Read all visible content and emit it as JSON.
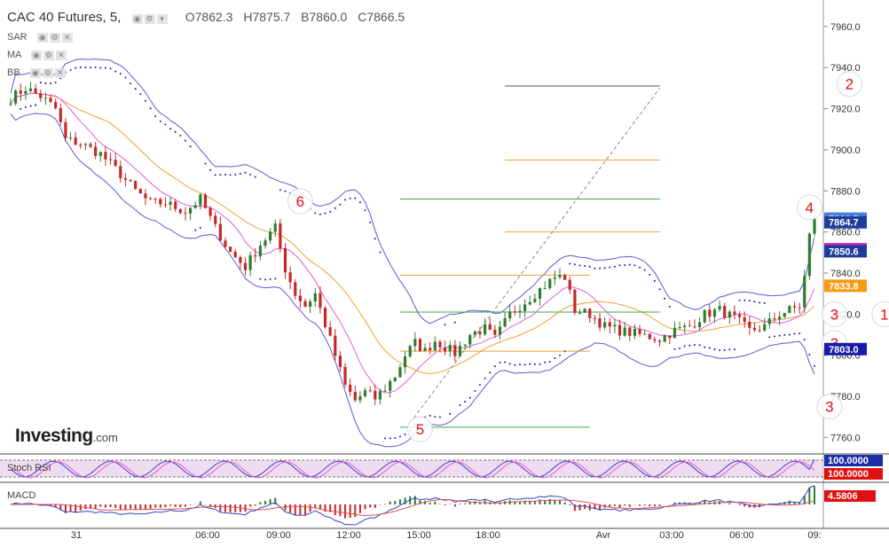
{
  "header": {
    "title": "CAC 40 Futures, 5,",
    "ohlc": {
      "open": "O7862.3",
      "high": "H7875.7",
      "low": "B7860.0",
      "close": "C7866.5"
    }
  },
  "indicators": [
    "SAR",
    "MA",
    "BB"
  ],
  "logo": {
    "name": "Investing",
    "suffix": ".com"
  },
  "chart_data": {
    "type": "candlestick",
    "price_axis": {
      "ylim": [
        7752,
        7972
      ],
      "ticks": [
        "7960.0",
        "7940.0",
        "7920.0",
        "7900.0",
        "7880.0",
        "7860.0",
        "7840.0",
        "7820.0",
        "7800.0",
        "7780.0",
        "7760.0"
      ]
    },
    "time_axis": {
      "labels": [
        "31",
        "06:00",
        "09:00",
        "12:00",
        "15:00",
        "18:00",
        "Avr",
        "03:00",
        "06:00",
        "09:"
      ]
    },
    "close_path": [
      [
        0,
        7925
      ],
      [
        3,
        7930
      ],
      [
        6,
        7926
      ],
      [
        9,
        7920
      ],
      [
        11,
        7905
      ],
      [
        14,
        7903
      ],
      [
        18,
        7898
      ],
      [
        22,
        7888
      ],
      [
        25,
        7880
      ],
      [
        28,
        7874
      ],
      [
        31,
        7874
      ],
      [
        35,
        7870
      ],
      [
        38,
        7876
      ],
      [
        41,
        7862
      ],
      [
        44,
        7850
      ],
      [
        47,
        7843
      ],
      [
        50,
        7854
      ],
      [
        53,
        7862
      ],
      [
        55,
        7842
      ],
      [
        57,
        7830
      ],
      [
        59,
        7824
      ],
      [
        61,
        7830
      ],
      [
        63,
        7815
      ],
      [
        65,
        7800
      ],
      [
        67,
        7785
      ],
      [
        69,
        7778
      ],
      [
        71,
        7782
      ],
      [
        73,
        7779
      ],
      [
        75,
        7784
      ],
      [
        77,
        7790
      ],
      [
        79,
        7800
      ],
      [
        81,
        7806
      ],
      [
        83,
        7802
      ],
      [
        85,
        7807
      ],
      [
        87,
        7804
      ],
      [
        89,
        7801
      ],
      [
        92,
        7810
      ],
      [
        95,
        7813
      ],
      [
        97,
        7808
      ],
      [
        100,
        7820
      ],
      [
        103,
        7826
      ],
      [
        106,
        7832
      ],
      [
        109,
        7838
      ],
      [
        111,
        7838
      ],
      [
        113,
        7822
      ],
      [
        116,
        7820
      ],
      [
        119,
        7814
      ],
      [
        122,
        7812
      ],
      [
        126,
        7810
      ],
      [
        130,
        7808
      ],
      [
        133,
        7812
      ],
      [
        136,
        7814
      ],
      [
        139,
        7820
      ],
      [
        142,
        7822
      ],
      [
        145,
        7818
      ],
      [
        148,
        7812
      ],
      [
        151,
        7814
      ],
      [
        154,
        7820
      ],
      [
        156,
        7822
      ],
      [
        158,
        7824
      ],
      [
        159,
        7838
      ],
      [
        160,
        7858
      ],
      [
        161,
        7866.5
      ]
    ],
    "price_tags": [
      {
        "value": "7866.5",
        "price": 7866.5,
        "color": "#4a7fdb"
      },
      {
        "value": "7864.7",
        "price": 7864.7,
        "color": "#1c3d9c"
      },
      {
        "value": "7851.6",
        "price": 7851.6,
        "color": "#e01ec4"
      },
      {
        "value": "7850.6",
        "price": 7850.6,
        "color": "#1c3d9c"
      },
      {
        "value": "7833.8",
        "price": 7833.8,
        "color": "#f59b12"
      },
      {
        "value": "7803.0",
        "price": 7803.0,
        "color": "#1a1aa8"
      }
    ],
    "horizontal_levels": [
      {
        "price": 7931,
        "x": [
          99,
          130
        ],
        "color": "#555555"
      },
      {
        "price": 7895,
        "x": [
          99,
          130
        ],
        "color": "#f0a030"
      },
      {
        "price": 7876,
        "x": [
          78,
          130
        ],
        "color": "#3aa84a"
      },
      {
        "price": 7860,
        "x": [
          99,
          130
        ],
        "color": "#f0a030"
      },
      {
        "price": 7839,
        "x": [
          78,
          116
        ],
        "color": "#f0a030"
      },
      {
        "price": 7821,
        "x": [
          78,
          130
        ],
        "color": "#3aa84a"
      },
      {
        "price": 7802,
        "x": [
          78,
          116
        ],
        "color": "#f0a030"
      },
      {
        "price": 7765,
        "x": [
          78,
          116
        ],
        "color": "#3aa84a"
      }
    ],
    "trend_line": {
      "from": [
        80,
        7767
      ],
      "to": [
        130,
        7930
      ]
    },
    "wave_labels": [
      {
        "text": "2",
        "x": 168,
        "price": 7932,
        "circle": true
      },
      {
        "text": "6",
        "x": 58,
        "price": 7875,
        "circle": true
      },
      {
        "text": "4",
        "x": 160,
        "price": 7872,
        "circle": true
      },
      {
        "text": "3",
        "x": 165,
        "price": 7820,
        "circle": true
      },
      {
        "text": "1",
        "x": 175,
        "price": 7820,
        "circle": true
      },
      {
        "text": "3",
        "x": 165,
        "price": 7806,
        "circle": true
      },
      {
        "text": "5",
        "x": 82,
        "price": 7764,
        "circle": true
      },
      {
        "text": "3",
        "x": 164,
        "price": 7775,
        "circle": true
      }
    ],
    "sub_panels": [
      {
        "name": "Stoch RSI",
        "tag": "100.0000",
        "tag2": "100.0000"
      },
      {
        "name": "MACD",
        "tag": "4.5806"
      }
    ]
  }
}
